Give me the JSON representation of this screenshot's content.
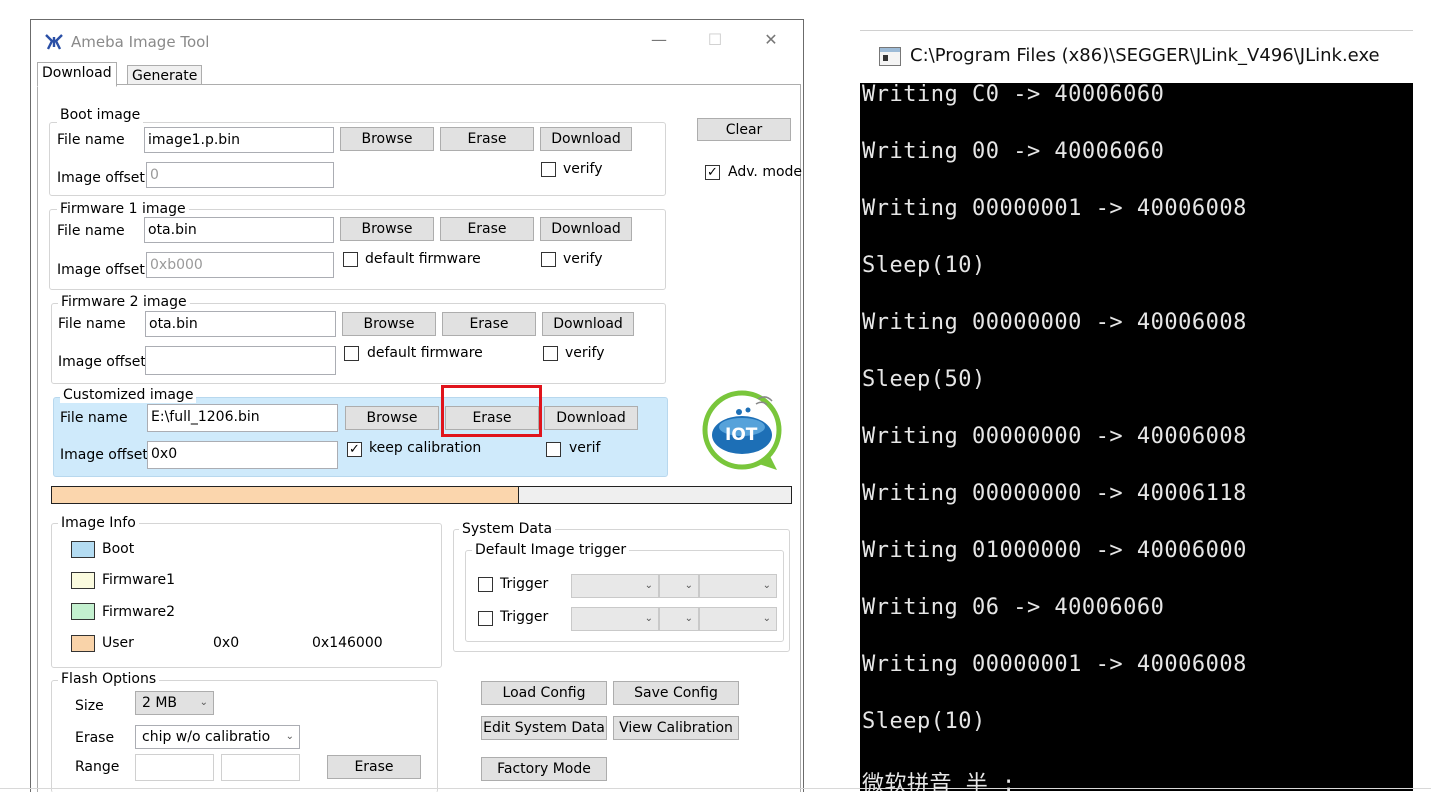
{
  "app": {
    "title": "Ameba Image Tool",
    "min_symbol": "—",
    "max_symbol": "☐",
    "close_symbol": "✕",
    "tabs": [
      "Download",
      "Generate"
    ],
    "clear_label": "Clear",
    "adv_mode_label": "Adv. mode"
  },
  "boot": {
    "group_label": "Boot image",
    "file_label": "File name",
    "file_value": "image1.p.bin",
    "offset_label": "Image offset",
    "offset_value": "0",
    "browse": "Browse",
    "erase": "Erase",
    "download": "Download",
    "verify": "verify"
  },
  "fw1": {
    "group_label": "Firmware 1 image",
    "file_label": "File name",
    "file_value": "ota.bin",
    "offset_label": "Image offset",
    "offset_value": "0xb000",
    "browse": "Browse",
    "erase": "Erase",
    "download": "Download",
    "default_fw": "default firmware",
    "verify": "verify"
  },
  "fw2": {
    "group_label": "Firmware 2 image",
    "file_label": "File name",
    "file_value": "ota.bin",
    "offset_label": "Image offset",
    "offset_value": "",
    "browse": "Browse",
    "erase": "Erase",
    "download": "Download",
    "default_fw": "default firmware",
    "verify": "verify"
  },
  "custom": {
    "group_label": "Customized image",
    "file_label": "File name",
    "file_value": "E:\\full_1206.bin",
    "offset_label": "Image offset",
    "offset_value": "0x0",
    "browse": "Browse",
    "erase": "Erase",
    "download": "Download",
    "keep_cal": "keep calibration",
    "verify": "verif"
  },
  "progress": {
    "fraction": 0.63
  },
  "logo": {
    "text": "IOT"
  },
  "image_info": {
    "group_label": "Image Info",
    "items": [
      {
        "label": "Boot",
        "color": "#b4dcf2"
      },
      {
        "label": "Firmware1",
        "color": "#fbfbdf"
      },
      {
        "label": "Firmware2",
        "color": "#c3f0cf"
      },
      {
        "label": "User",
        "color": "#f9d3a9"
      }
    ],
    "user_start": "0x0",
    "user_end": "0x146000"
  },
  "system_data": {
    "group_label": "System Data",
    "sub_label": "Default Image trigger",
    "trigger_label": "Trigger"
  },
  "flash": {
    "group_label": "Flash Options",
    "size_label": "Size",
    "size_value": "2 MB",
    "erase_label": "Erase",
    "erase_value": "chip w/o calibratio",
    "range_label": "Range",
    "erase_button": "Erase"
  },
  "config": {
    "load": "Load Config",
    "save": "Save Config",
    "edit": "Edit System Data",
    "view": "View Calibration",
    "factory": "Factory Mode"
  },
  "terminal": {
    "title": "C:\\Program Files (x86)\\SEGGER\\JLink_V496\\JLink.exe",
    "lines": [
      "Writing C0 -> 40006060",
      "Writing 00 -> 40006060",
      "Writing 00000001 -> 40006008",
      "Sleep(10)",
      "Writing 00000000 -> 40006008",
      "Sleep(50)",
      "Writing 00000000 -> 40006008",
      "Writing 00000000 -> 40006118",
      "Writing 01000000 -> 40006000",
      "Writing 06 -> 40006060",
      "Writing 00000001 -> 40006008",
      "Sleep(10)",
      "微软拼音 半 :"
    ]
  },
  "colors": {
    "highlight_box": "#e0141c",
    "custom_bg": "#cfeafb",
    "progress_fill": "#fbd6ad",
    "terminal_bg": "#000000"
  }
}
